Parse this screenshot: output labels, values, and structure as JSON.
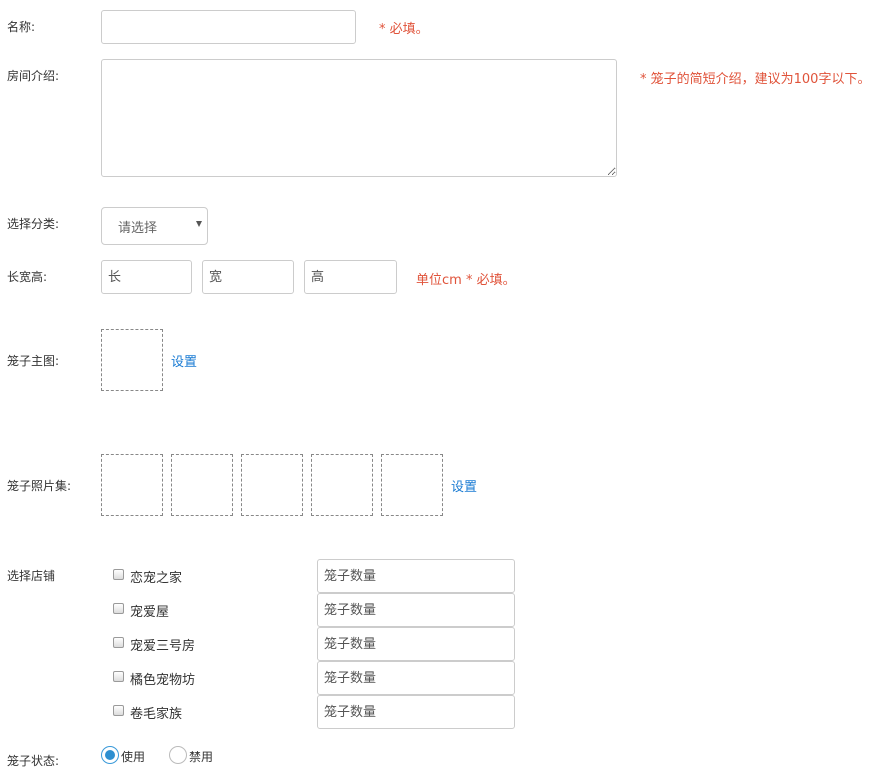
{
  "form": {
    "name": {
      "label": "名称:",
      "value": "",
      "hint": "* 必填。"
    },
    "intro": {
      "label": "房间介绍:",
      "value": "",
      "hint": "* 笼子的简短介绍，建议为100字以下。"
    },
    "category": {
      "label": "选择分类:",
      "selected": "请选择"
    },
    "size": {
      "label": "长宽高:",
      "length_placeholder": "长",
      "width_placeholder": "宽",
      "height_placeholder": "高",
      "hint": "单位cm * 必填。"
    },
    "main_image": {
      "label": "笼子主图:",
      "set_link": "设置"
    },
    "gallery": {
      "label": "笼子照片集:",
      "set_link": "设置"
    },
    "shops": {
      "label": "选择店铺",
      "quantity_placeholder": "笼子数量",
      "items": [
        {
          "name": "恋宠之家",
          "checked": false
        },
        {
          "name": "宠爱屋",
          "checked": false
        },
        {
          "name": "宠爱三号房",
          "checked": false
        },
        {
          "name": "橘色宠物坊",
          "checked": false
        },
        {
          "name": "卷毛家族",
          "checked": false
        }
      ]
    },
    "status": {
      "label": "笼子状态:",
      "options": [
        {
          "label": "使用",
          "selected": true
        },
        {
          "label": "禁用",
          "selected": false
        }
      ]
    }
  },
  "colors": {
    "hint": "#e0533a",
    "link": "#1a7bd3",
    "radio_selected": "#2e8fd0"
  }
}
